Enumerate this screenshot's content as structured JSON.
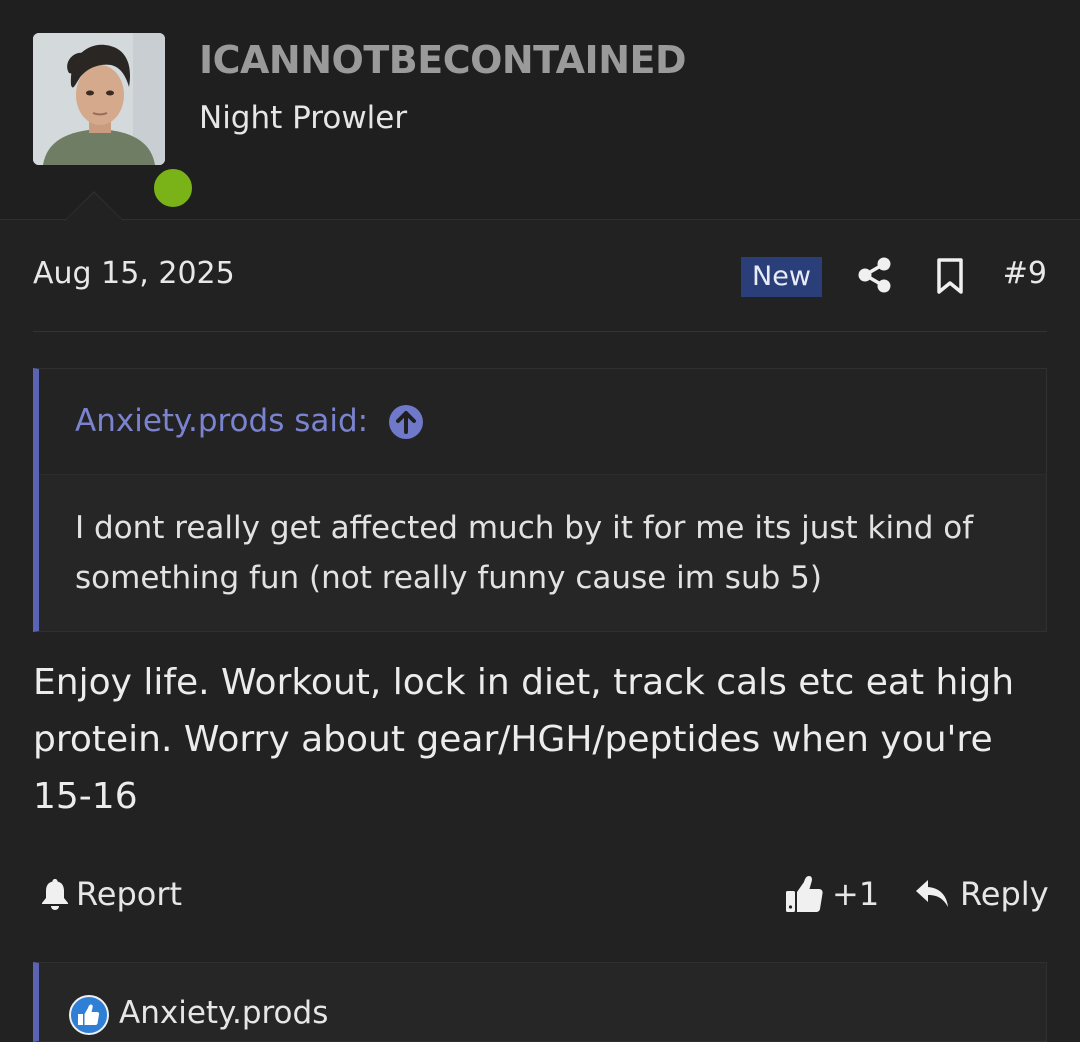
{
  "user": {
    "username": "ICANNOTBECONTAINED",
    "title": "Night Prowler",
    "status": "online",
    "status_color": "#7ab317"
  },
  "post": {
    "date": "Aug 15, 2025",
    "badge": "New",
    "number": "#9",
    "icons": [
      "share-icon",
      "bookmark-icon"
    ]
  },
  "quote": {
    "author": "Anxiety.prods said:",
    "text": "I dont really get affected much by it for me its just kind of something fun (not really funny cause im sub 5)",
    "accent_color": "#5b63b5"
  },
  "message": {
    "text": "Enjoy life. Workout, lock in diet, track cals etc eat high protein. Worry about gear/HGH/peptides when you're 15-16"
  },
  "actions": {
    "report_label": "Report",
    "like_count": "+1",
    "reply_label": "Reply"
  },
  "reactions": {
    "user": "Anxiety.prods",
    "icon": "thumbs-up-icon"
  }
}
